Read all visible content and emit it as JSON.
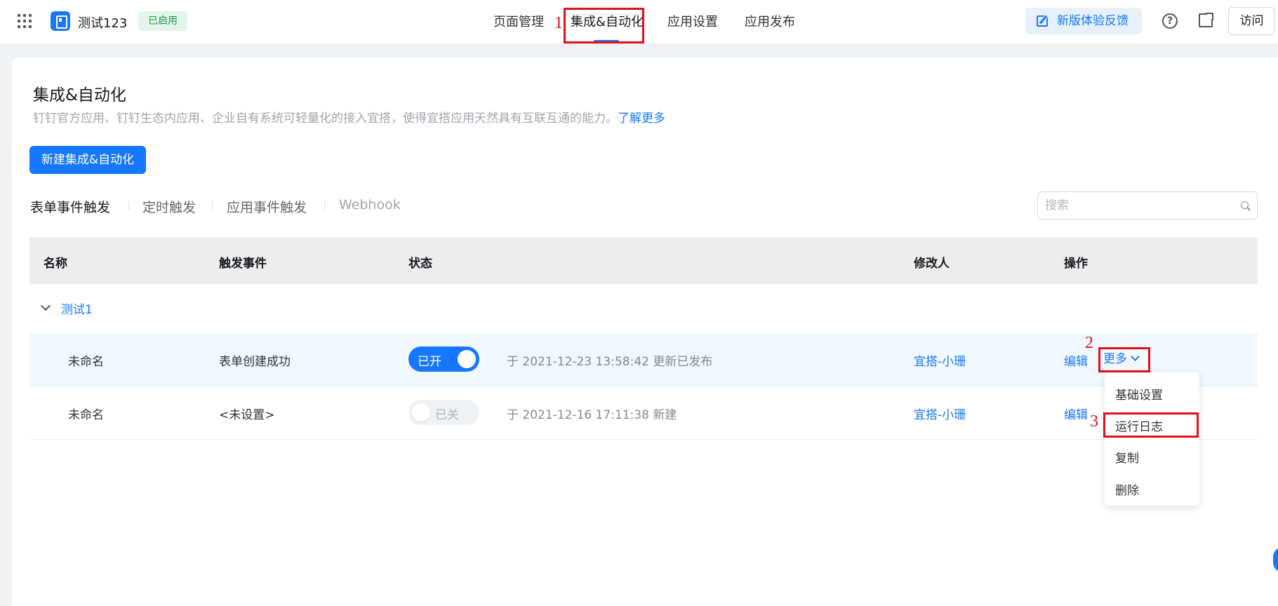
{
  "topbar": {
    "app_name": "测试123",
    "status_badge": "已启用",
    "nav": [
      "页面管理",
      "集成&自动化",
      "应用设置",
      "应用发布"
    ],
    "active_nav": "集成&自动化",
    "feedback_label": "新版体验反馈",
    "help_icon": "?",
    "visit_label": "访问"
  },
  "page": {
    "title": "集成&自动化",
    "description": "钉钉官方应用、钉钉生态内应用、企业自有系统可轻量化的接入宜搭，使得宜搭应用天然具有互联互通的能力。",
    "learn_more": "了解更多",
    "new_button": "新建集成&自动化"
  },
  "filters": {
    "tabs": [
      "表单事件触发",
      "定时触发",
      "应用事件触发",
      "Webhook"
    ],
    "active": "表单事件触发"
  },
  "search": {
    "placeholder": "搜索"
  },
  "table": {
    "columns": [
      "名称",
      "触发事件",
      "状态",
      "修改人",
      "操作"
    ],
    "group": "测试1",
    "rows": [
      {
        "name": "未命名",
        "event": "表单创建成功",
        "toggle": "已开",
        "enabled": true,
        "log": "于 2021-12-23 13:58:42 更新已发布",
        "modifier": "宜搭-小珊",
        "edit": "编辑",
        "more": "更多"
      },
      {
        "name": "未命名",
        "event": "<未设置>",
        "toggle": "已关",
        "enabled": false,
        "log": "于 2021-12-16 17:11:38 新建",
        "modifier": "宜搭-小珊",
        "edit": "编辑"
      }
    ]
  },
  "dropdown": {
    "items": [
      "基础设置",
      "运行日志",
      "复制",
      "删除"
    ]
  },
  "annotations": {
    "marks": [
      "1",
      "2",
      "3"
    ],
    "color": "#e0101a"
  },
  "colors": {
    "primary": "#1677ff",
    "success_tag_bg": "#e3f5ea",
    "success_tag_text": "#1a9a4b"
  }
}
